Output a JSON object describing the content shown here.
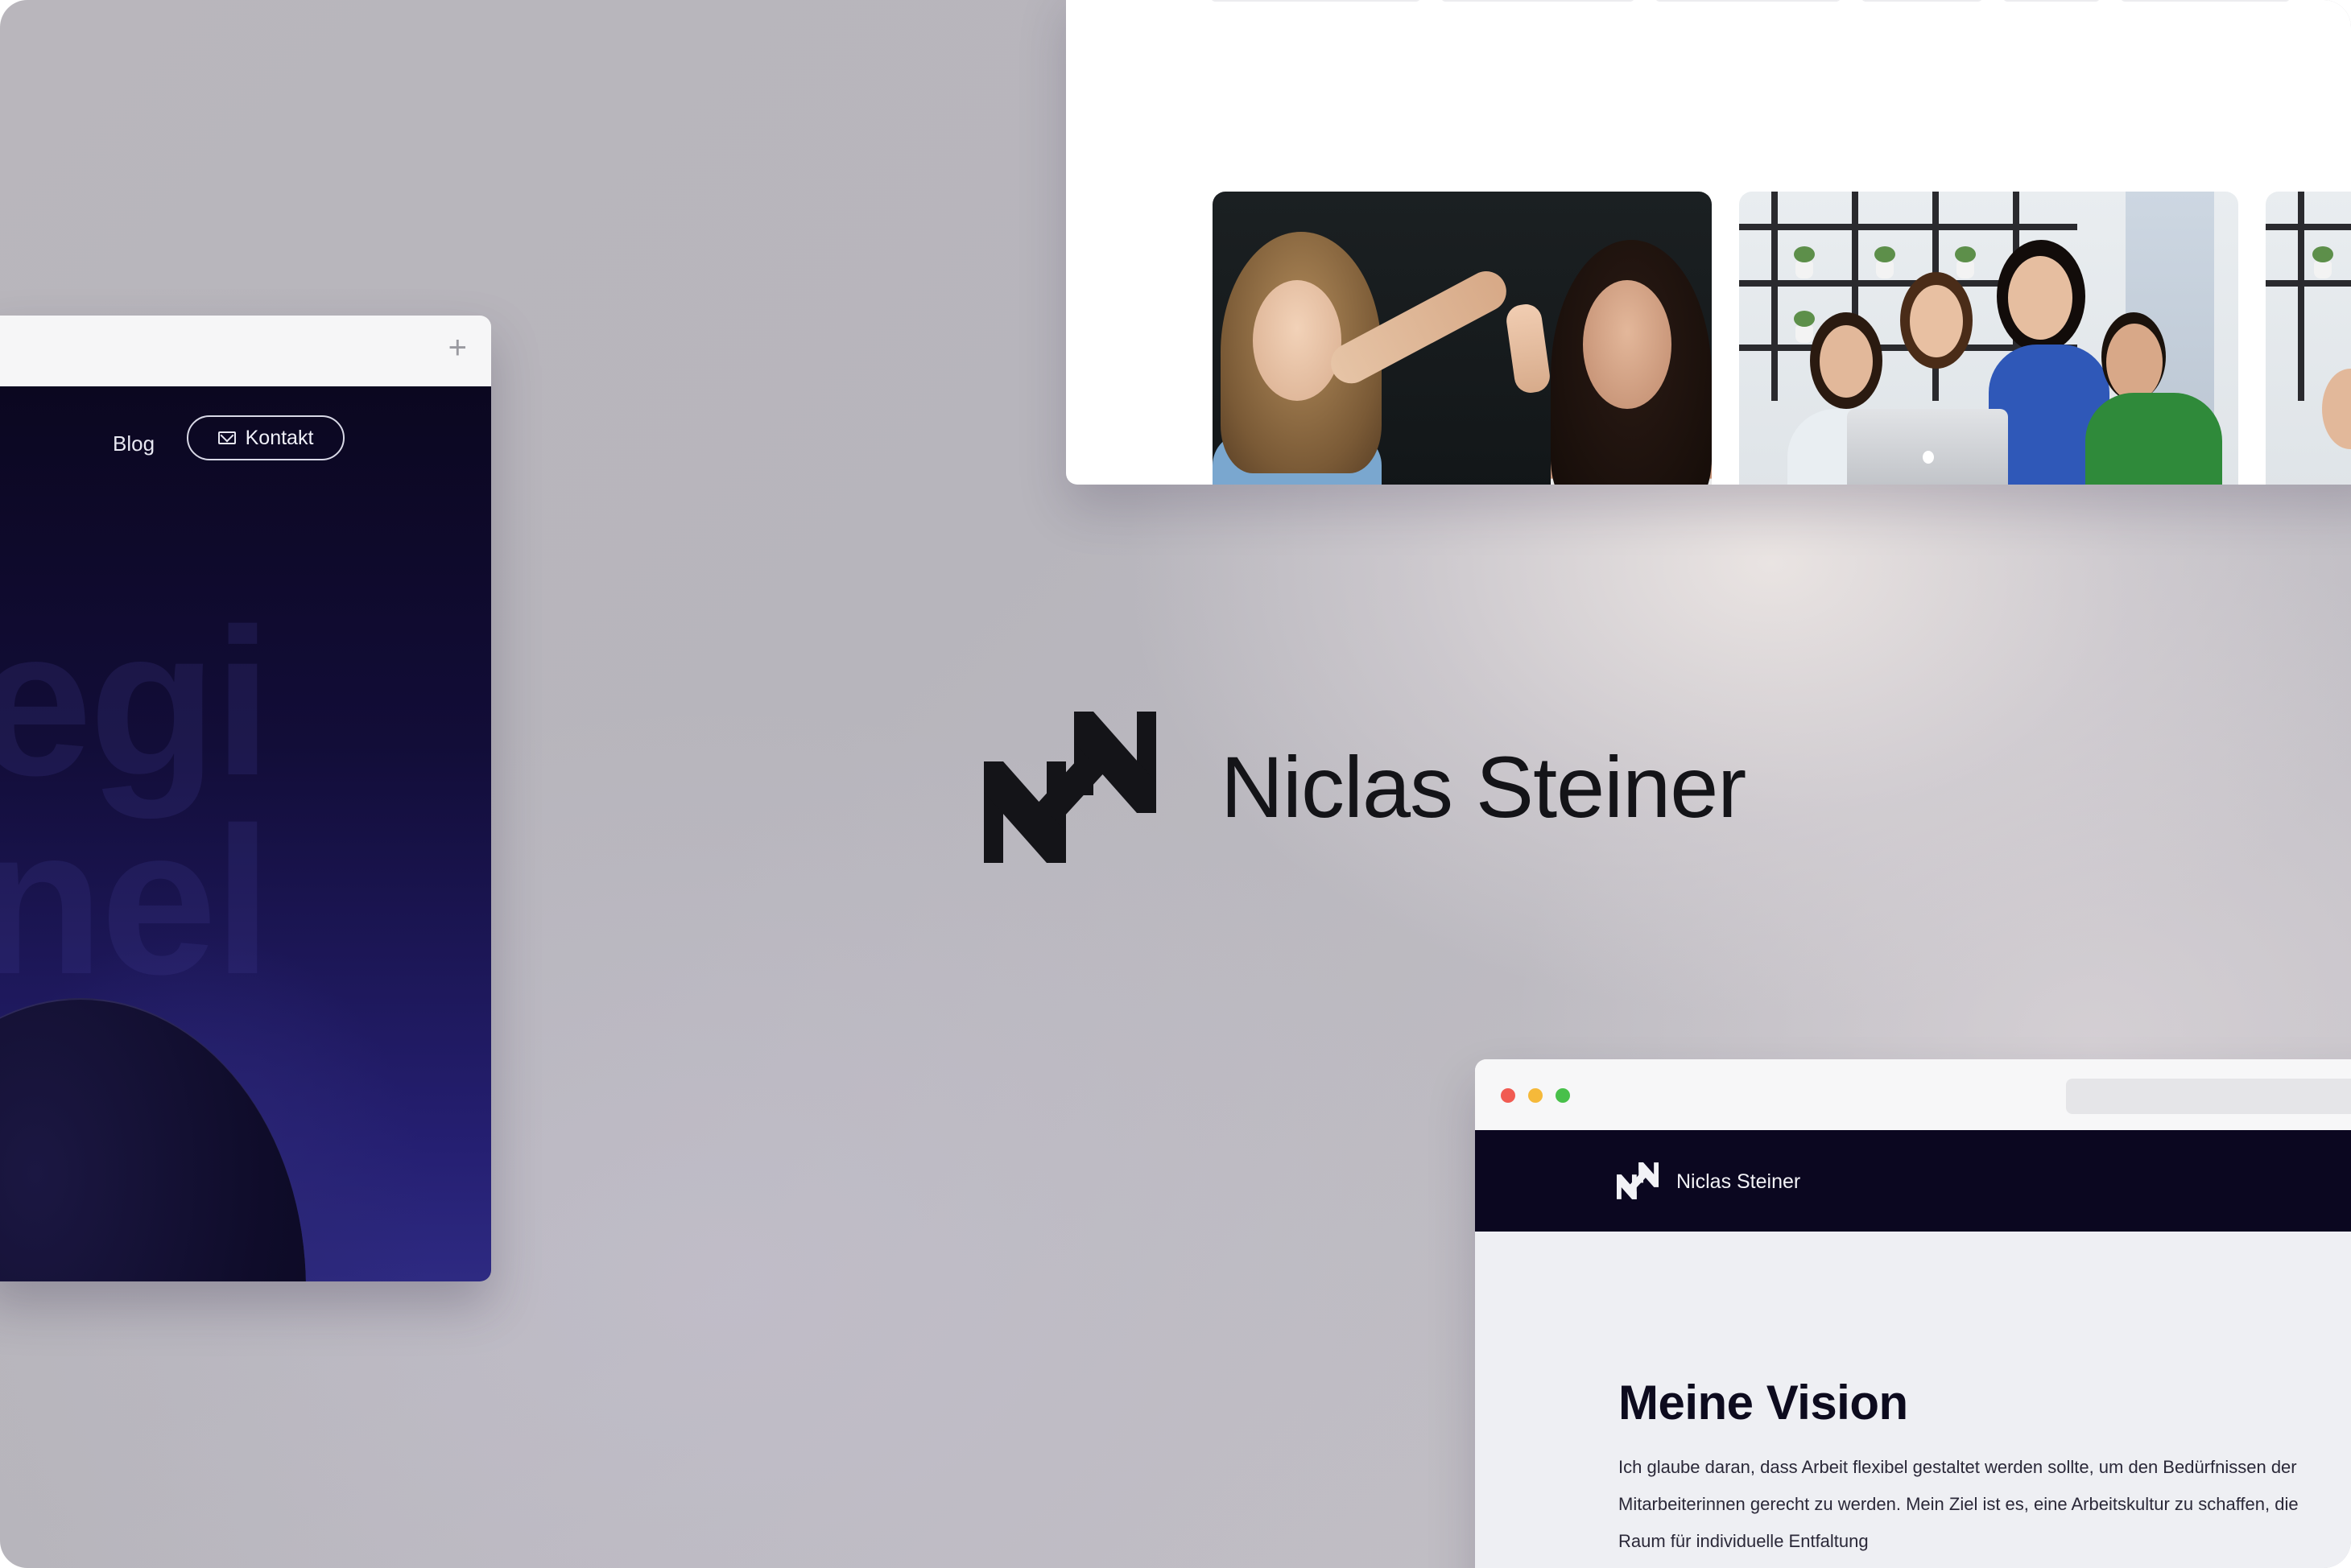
{
  "brand": {
    "name": "Niclas Steiner"
  },
  "left_window": {
    "nav": {
      "blog_label": "Blog",
      "contact_label": "Kontakt"
    },
    "hero_ghost_text": "egi\nnel"
  },
  "bottom_right_window": {
    "site_name": "Niclas Steiner",
    "heading": "Meine Vision",
    "paragraph": "Ich glaube daran, dass Arbeit flexibel gestaltet werden sollte, um den Bedürfnissen der Mitarbeiterinnen gerecht zu werden. Mein Ziel ist es, eine Arbeitskultur zu schaffen, die Raum für individuelle Entfaltung"
  },
  "colors": {
    "dark_navy": "#0b0720",
    "hero_purple": "#2e2a82",
    "brand_black": "#141418",
    "traffic_red": "#f15b52",
    "traffic_yellow": "#f5b93a",
    "traffic_green": "#48c04a"
  },
  "icons": {
    "brand_logo": "ns-monogram-icon",
    "contact": "mail-icon",
    "new_tab": "plus-icon"
  }
}
